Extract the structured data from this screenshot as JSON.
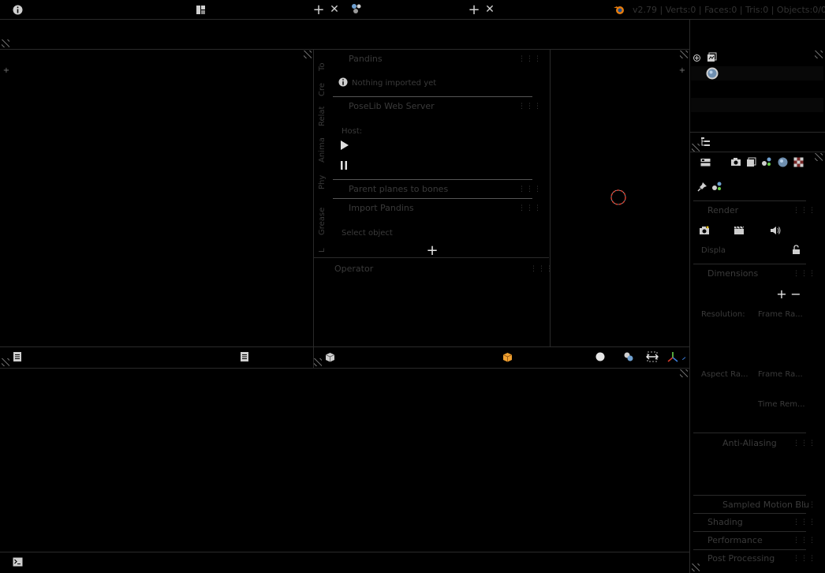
{
  "topbar": {
    "stats": "v2.79 | Verts:0 | Faces:0 | Tris:0 | Objects:0/0 | ",
    "info_icon": "info-icon",
    "layout_icon": "layout-icon",
    "add_icon": "+",
    "close_icon": "✕"
  },
  "tools_panel": {
    "tabs": [
      "To",
      "Cre",
      "Relat",
      "Anima",
      "Phy",
      "Grease",
      "L"
    ],
    "pandins_header": "Pandins",
    "nothing_imported": "Nothing imported yet",
    "poselib_header": "PoseLib Web Server",
    "host_label": "Host:",
    "parent_planes": "Parent planes to bones",
    "import_pandins": "Import Pandins",
    "select_object": "Select object",
    "operator_header": "Operator"
  },
  "properties": {
    "render_header": "Render",
    "display_label": "Displa",
    "dimensions_header": "Dimensions",
    "resolution_label": "Resolution:",
    "frame_range_label": "Frame Ra...",
    "aspect_label": "Aspect Ra...",
    "frame_rate_label": "Frame Ra...",
    "time_remap_label": "Time Rem...",
    "anti_aliasing_header": "Anti-Aliasing",
    "sampled_motion_header": "Sampled Motion Blu",
    "shading_header": "Shading",
    "performance_header": "Performance",
    "post_processing_header": "Post Processing"
  },
  "colors": {
    "background": "#000000",
    "dim_text": "#3a3a3a",
    "icon_light": "#cfcfcf",
    "blender_orange": "#e87d0d",
    "cursor_red": "#d63a2a"
  }
}
